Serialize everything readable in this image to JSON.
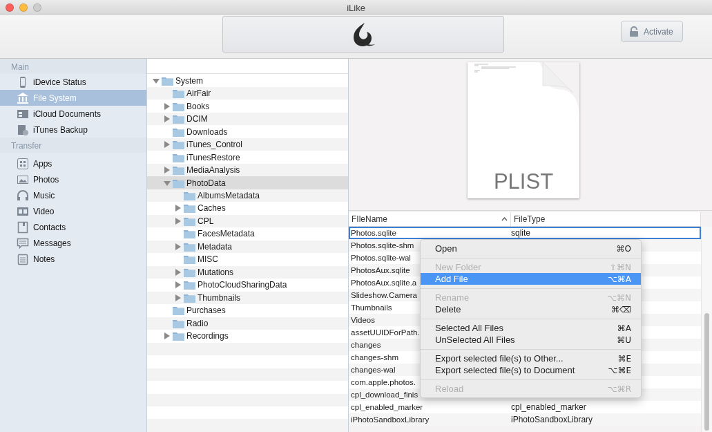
{
  "window": {
    "title": "iLike"
  },
  "toolbar": {
    "activate_button": "Activate"
  },
  "sidebar": {
    "sections": [
      {
        "title": "Main",
        "items": [
          {
            "label": "iDevice Status",
            "kind": "phone",
            "selected": false
          },
          {
            "label": "File System",
            "kind": "building",
            "selected": true
          },
          {
            "label": "iCloud Documents",
            "kind": "window",
            "selected": false
          },
          {
            "label": "iTunes Backup",
            "kind": "backup",
            "selected": false
          }
        ]
      },
      {
        "title": "Transfer",
        "items": [
          {
            "label": "Apps",
            "kind": "grid",
            "selected": false
          },
          {
            "label": "Photos",
            "kind": "photo",
            "selected": false
          },
          {
            "label": "Music",
            "kind": "headphones",
            "selected": false
          },
          {
            "label": "Video",
            "kind": "film",
            "selected": false
          },
          {
            "label": "Contacts",
            "kind": "book",
            "selected": false
          },
          {
            "label": "Messages",
            "kind": "message",
            "selected": false
          },
          {
            "label": "Notes",
            "kind": "note",
            "selected": false
          }
        ]
      }
    ]
  },
  "tree": [
    {
      "label": "System",
      "kind": "branch",
      "expanded": true,
      "selected": false,
      "children": [
        {
          "label": "AirFair",
          "kind": "leaf",
          "expanded": false,
          "selected": false
        },
        {
          "label": "Books",
          "kind": "branch",
          "expanded": false,
          "selected": false
        },
        {
          "label": "DCIM",
          "kind": "branch",
          "expanded": false,
          "selected": false
        },
        {
          "label": "Downloads",
          "kind": "leaf",
          "expanded": false,
          "selected": false
        },
        {
          "label": "iTunes_Control",
          "kind": "branch",
          "expanded": false,
          "selected": false
        },
        {
          "label": "iTunesRestore",
          "kind": "leaf",
          "expanded": false,
          "selected": false
        },
        {
          "label": "MediaAnalysis",
          "kind": "branch",
          "expanded": false,
          "selected": false
        },
        {
          "label": "PhotoData",
          "kind": "branch",
          "expanded": true,
          "selected": true,
          "children": [
            {
              "label": "AlbumsMetadata",
              "kind": "leaf",
              "expanded": false,
              "selected": false
            },
            {
              "label": "Caches",
              "kind": "branch",
              "expanded": false,
              "selected": false
            },
            {
              "label": "CPL",
              "kind": "branch",
              "expanded": false,
              "selected": false
            },
            {
              "label": "FacesMetadata",
              "kind": "leaf",
              "expanded": false,
              "selected": false
            },
            {
              "label": "Metadata",
              "kind": "branch",
              "expanded": false,
              "selected": false
            },
            {
              "label": "MISC",
              "kind": "leaf",
              "expanded": false,
              "selected": false
            },
            {
              "label": "Mutations",
              "kind": "branch",
              "expanded": false,
              "selected": false
            },
            {
              "label": "PhotoCloudSharingData",
              "kind": "branch",
              "expanded": false,
              "selected": false
            },
            {
              "label": "Thumbnails",
              "kind": "branch",
              "expanded": false,
              "selected": false
            }
          ]
        },
        {
          "label": "Purchases",
          "kind": "leaf",
          "expanded": false,
          "selected": false
        },
        {
          "label": "Radio",
          "kind": "leaf",
          "expanded": false,
          "selected": false
        },
        {
          "label": "Recordings",
          "kind": "branch",
          "expanded": false,
          "selected": false
        }
      ]
    }
  ],
  "preview": {
    "file_label": "PLIST"
  },
  "table": {
    "columns": [
      "FIleName",
      "FileType"
    ],
    "rows": [
      {
        "name": "Photos.sqlite",
        "type": "sqlite",
        "selected": true
      },
      {
        "name": "Photos.sqlite-shm",
        "selected": false
      },
      {
        "name": "Photos.sqlite-wal",
        "selected": false
      },
      {
        "name": "PhotosAux.sqlite",
        "selected": false
      },
      {
        "name": "PhotosAux.sqlite.a",
        "selected": false
      },
      {
        "name": "Slideshow.Camera",
        "selected": false
      },
      {
        "name": "Thumbnails",
        "selected": false
      },
      {
        "name": "Videos",
        "selected": false
      },
      {
        "name": "assetUUIDForPath.",
        "selected": false
      },
      {
        "name": "changes",
        "selected": false
      },
      {
        "name": "changes-shm",
        "selected": false
      },
      {
        "name": "changes-wal",
        "selected": false
      },
      {
        "name": "com.apple.photos.",
        "selected": false
      },
      {
        "name": "cpl_download_finis",
        "selected": false
      },
      {
        "name": "cpl_enabled_marker",
        "type": "cpl_enabled_marker",
        "selected": false
      },
      {
        "name": "iPhotoSandboxLibrary",
        "type": "iPhotoSandboxLibrary",
        "selected": false
      }
    ]
  },
  "context_menu": {
    "groups": [
      [
        {
          "label": "Open",
          "shortcut": "⌘O",
          "disabled": false,
          "selected": false
        }
      ],
      [
        {
          "label": "New Folder",
          "shortcut": "⇧⌘N",
          "disabled": true,
          "selected": false
        },
        {
          "label": "Add File",
          "shortcut": "⌥⌘A",
          "disabled": false,
          "selected": true
        }
      ],
      [
        {
          "label": "Rename",
          "shortcut": "⌥⌘N",
          "disabled": true,
          "selected": false
        },
        {
          "label": "Delete",
          "shortcut": "⌘⌫",
          "disabled": false,
          "selected": false
        }
      ],
      [
        {
          "label": "Selected All Files",
          "shortcut": "⌘A",
          "disabled": false,
          "selected": false
        },
        {
          "label": "UnSelected All Files",
          "shortcut": "⌘U",
          "disabled": false,
          "selected": false
        }
      ],
      [
        {
          "label": "Export selected file(s) to Other...",
          "shortcut": "⌘E",
          "disabled": false,
          "selected": false
        },
        {
          "label": "Export selected file(s) to Document",
          "shortcut": "⌥⌘E",
          "disabled": false,
          "selected": false
        }
      ],
      [
        {
          "label": "Reload",
          "shortcut": "⌥⌘R",
          "disabled": true,
          "selected": false
        }
      ]
    ]
  }
}
